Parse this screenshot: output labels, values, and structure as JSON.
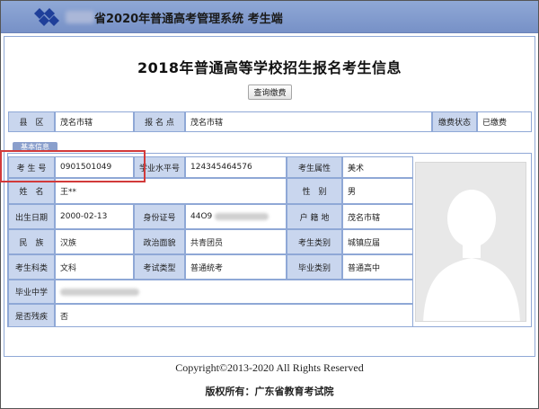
{
  "header": {
    "title": "省2020年普通高考管理系统  考生端"
  },
  "page": {
    "title": "2018年普通高等学校招生报名考生信息",
    "query_button": "查询缴费"
  },
  "top_row": {
    "county_label": "县　区",
    "county_value": "茂名市辖",
    "site_label": "报 名 点",
    "site_value": "茂名市辖",
    "fee_label": "缴费状态",
    "fee_value": "已缴费"
  },
  "tab_label": "基本信息",
  "info": {
    "exam_no_label": "考 生 号",
    "exam_no_value": "0901501049",
    "level_label": "学业水平号",
    "level_value": "124345464576",
    "attr_label": "考生属性",
    "attr_value": "美术",
    "name_label": "姓　名",
    "name_value": "王**",
    "gender_label": "性　别",
    "gender_value": "男",
    "birth_label": "出生日期",
    "birth_value": "2000-02-13",
    "id_label": "身份证号",
    "id_value": "44O9",
    "hukou_label": "户 籍 地",
    "hukou_value": "茂名市辖",
    "ethnic_label": "民　族",
    "ethnic_value": "汉族",
    "political_label": "政治面貌",
    "political_value": "共青团员",
    "category_label": "考生类别",
    "category_value": "城镇应届",
    "subject_label": "考生科类",
    "subject_value": "文科",
    "exam_type_label": "考试类型",
    "exam_type_value": "普通统考",
    "grad_type_label": "毕业类别",
    "grad_type_value": "普通高中",
    "school_label": "毕业中学",
    "disabled_label": "是否残疾",
    "disabled_value": "否"
  },
  "footer": {
    "copyright": "Copyright©2013-2020    All  Rights  Reserved",
    "rights": "版权所有：广东省教育考试院"
  },
  "colors": {
    "header_bg": "#8fa8d6",
    "label_bg": "#c9d6ee",
    "border": "#8fa8d6",
    "highlight": "#d23a3a"
  }
}
